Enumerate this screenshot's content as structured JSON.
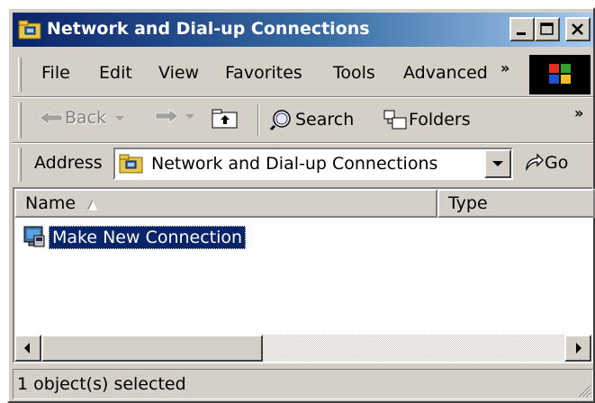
{
  "window": {
    "title": "Network and Dial-up Connections",
    "accent": "#0a246a",
    "face": "#d4d0c8"
  },
  "menu": {
    "items": [
      "File",
      "Edit",
      "View",
      "Favorites",
      "Tools",
      "Advanced"
    ],
    "more_chevron": "»"
  },
  "toolbar": {
    "back_label": "Back",
    "search_label": "Search",
    "folders_label": "Folders",
    "more_chevron": "»"
  },
  "address": {
    "label": "Address",
    "value": "Network and Dial-up Connections",
    "go_label": "Go"
  },
  "list": {
    "columns": [
      "Name",
      "Type"
    ],
    "sort_indicator": "▲",
    "items": [
      {
        "label": "Make New Connection",
        "icon": "make-new-connection-icon",
        "selected": true
      }
    ]
  },
  "status": {
    "text": "1 object(s) selected"
  }
}
